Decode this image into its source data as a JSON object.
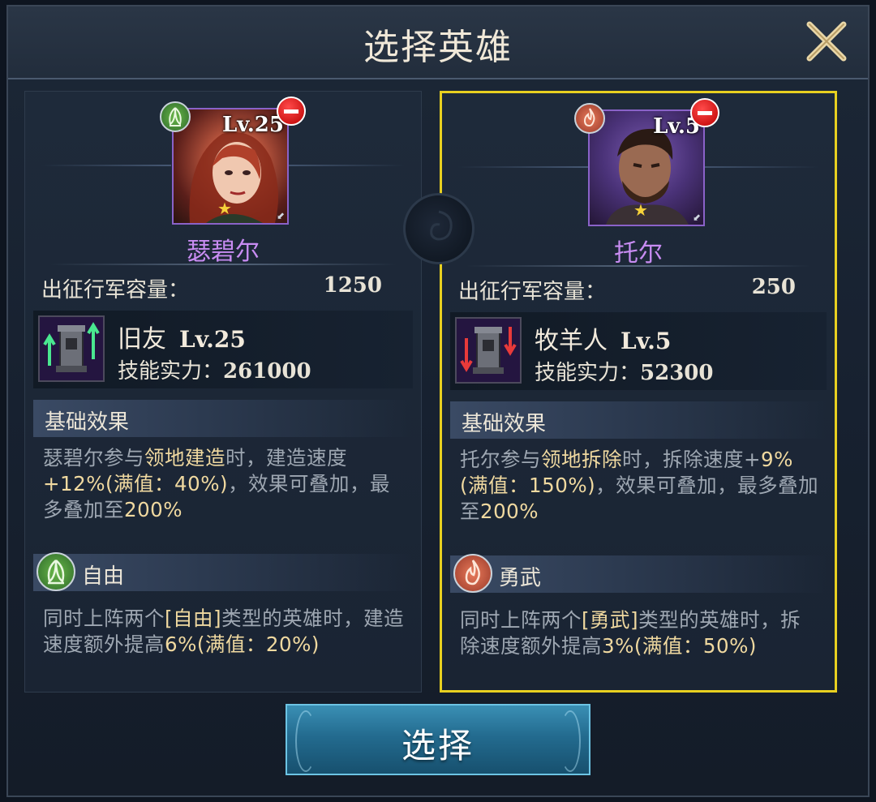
{
  "dialog": {
    "title": "选择英雄"
  },
  "heroes": [
    {
      "name": "瑟碧尔",
      "level": "Lv.25",
      "type": "自由",
      "type_color": "#5aa35a",
      "capacity_label": "出征行军容量：",
      "capacity_value": "1250",
      "skill": {
        "name": "旧友",
        "level": "Lv.25",
        "power_label": "技能实力：",
        "power_value": "261000",
        "trend": "up"
      },
      "base_effect_label": "基础效果",
      "base_effect": [
        {
          "text": "瑟碧尔参与",
          "hl": false
        },
        {
          "text": "领地建造",
          "hl": true
        },
        {
          "text": "时，建造速度",
          "hl": false
        },
        {
          "text": "+12%(满值：40%)",
          "hl": true
        },
        {
          "text": "，效果可叠加，最多叠加至",
          "hl": false
        },
        {
          "text": "200%",
          "hl": true
        }
      ],
      "type_effect": [
        {
          "text": "同时上阵两个",
          "hl": false
        },
        {
          "text": "[自由]",
          "hl": true
        },
        {
          "text": "类型的英雄时，建造速度额外提高",
          "hl": false
        },
        {
          "text": "6%(满值：20%)",
          "hl": true
        }
      ]
    },
    {
      "name": "托尔",
      "level": "Lv.5",
      "type": "勇武",
      "type_color": "#c8553f",
      "capacity_label": "出征行军容量：",
      "capacity_value": "250",
      "skill": {
        "name": "牧羊人",
        "level": "Lv.5",
        "power_label": "技能实力：",
        "power_value": "52300",
        "trend": "down"
      },
      "base_effect_label": "基础效果",
      "base_effect": [
        {
          "text": "托尔参与",
          "hl": false
        },
        {
          "text": "领地拆除",
          "hl": true
        },
        {
          "text": "时，拆除速度+",
          "hl": false
        },
        {
          "text": "9%(满值：150%)",
          "hl": true
        },
        {
          "text": "，效果可叠加，最多叠加至",
          "hl": false
        },
        {
          "text": "200%",
          "hl": true
        }
      ],
      "type_effect": [
        {
          "text": "同时上阵两个",
          "hl": false
        },
        {
          "text": "[勇武]",
          "hl": true
        },
        {
          "text": "类型的英雄时，拆除速度额外提高",
          "hl": false
        },
        {
          "text": "3%(满值：50%)",
          "hl": true
        }
      ]
    }
  ],
  "actions": {
    "select_label": "选择"
  },
  "icons": {
    "close": "close-icon",
    "remove": "remove-icon",
    "freedom_type": "leaf-icon",
    "valor_type": "flame-icon",
    "star": "star-icon"
  },
  "colors": {
    "selected_border": "#e8d020",
    "hero_name": "#c88cf2",
    "highlight": "#f0d9a0"
  }
}
